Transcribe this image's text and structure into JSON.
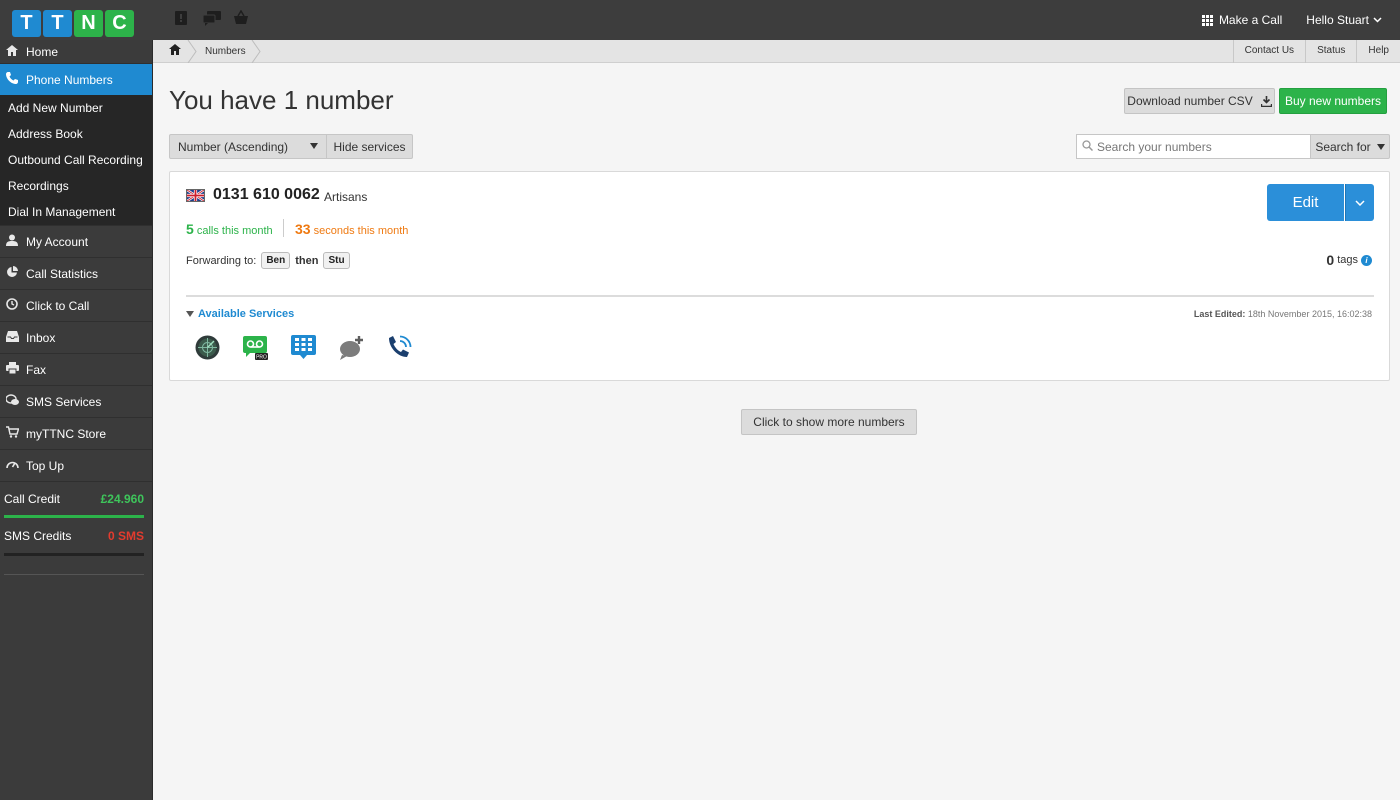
{
  "logo": {
    "letters": [
      "T",
      "T",
      "N",
      "C"
    ]
  },
  "topbar": {
    "icons": [
      "notice-icon",
      "chat-icon",
      "basket-icon"
    ],
    "make_call": "Make a Call",
    "user_greeting": "Hello Stuart"
  },
  "breadcrumb": {
    "current": "Numbers",
    "links": [
      "Contact Us",
      "Status",
      "Help"
    ]
  },
  "sidebar": {
    "home": "Home",
    "phone_numbers": "Phone Numbers",
    "sub_items": [
      "Add New Number",
      "Address Book",
      "Outbound Call Recording",
      "Recordings",
      "Dial In Management"
    ],
    "items": [
      "My Account",
      "Call Statistics",
      "Click to Call",
      "Inbox",
      "Fax",
      "SMS Services",
      "myTTNC Store",
      "Top Up"
    ],
    "call_credit_label": "Call Credit",
    "call_credit_value": "£24.960",
    "sms_credit_label": "SMS Credits",
    "sms_credit_value": "0 SMS"
  },
  "main": {
    "title": "You have 1 number",
    "download_csv": "Download number CSV",
    "buy_numbers": "Buy new numbers",
    "sort_value": "Number (Ascending)",
    "hide_services": "Hide services",
    "search_placeholder": "Search your numbers",
    "search_for": "Search for",
    "show_more": "Click to show more numbers"
  },
  "number_card": {
    "number": "0131 610 0062",
    "name": "Artisans",
    "calls_count": "5",
    "calls_label": "calls this month",
    "seconds_count": "33",
    "seconds_label": "seconds this month",
    "forwarding_label": "Forwarding to:",
    "forward_first": "Ben",
    "forward_then": "then",
    "forward_second": "Stu",
    "edit": "Edit",
    "tags_count": "0",
    "tags_label": "tags",
    "available_services": "Available Services",
    "last_edited_label": "Last Edited:",
    "last_edited_value": "18th November 2015, 16:02:38",
    "services": [
      "globe-radar-icon",
      "voicemail-pro-icon",
      "ivr-keypad-icon",
      "message-add-icon",
      "call-recording-icon"
    ]
  },
  "colors": {
    "brand_blue": "#1f8ad1",
    "brand_green": "#2cb34a",
    "seconds_orange": "#ef7a12",
    "sms_red": "#e33b2e"
  }
}
